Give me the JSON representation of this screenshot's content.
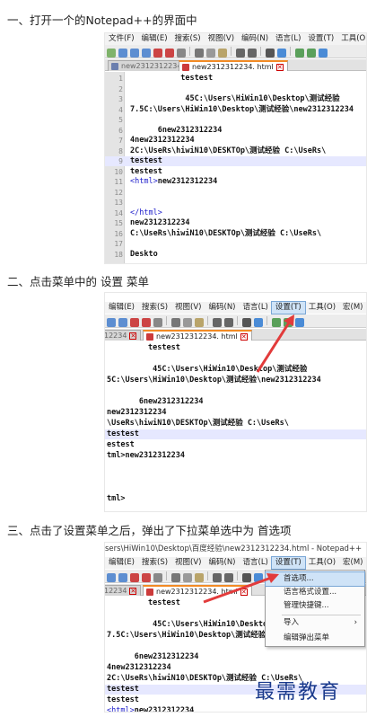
{
  "steps": {
    "one": "一、打开一个的Notepad++的界面中",
    "two": "二、点击菜单中的 设置 菜单",
    "three": "三、点击了设置菜单之后，弹出了下拉菜单选中为 首选项"
  },
  "shot1": {
    "menu": [
      "文件(F)",
      "编辑(E)",
      "搜索(S)",
      "视图(V)",
      "编码(N)",
      "语言(L)",
      "设置(T)",
      "工具(O)",
      "宏"
    ],
    "tab_inactive": "new2312312234",
    "tab_active": "new2312312234. html",
    "lines": [
      {
        "n": "1",
        "t": "           testest"
      },
      {
        "n": "2",
        "t": ""
      },
      {
        "n": "3",
        "t": "            45C:\\Users\\HiWin10\\Desktop\\测试经验"
      },
      {
        "n": "4",
        "t": "7.5C:\\Users\\HiWin10\\Desktop\\测试经验\\new2312312234"
      },
      {
        "n": "5",
        "t": ""
      },
      {
        "n": "6",
        "t": "      6new2312312234"
      },
      {
        "n": "7",
        "t": "4new2312312234"
      },
      {
        "n": "8",
        "t": "2C:\\UseRs\\hiwiN10\\DESKTOp\\测试经验 C:\\UseRs\\"
      },
      {
        "n": "9",
        "t": "testest"
      },
      {
        "n": "10",
        "t": "testest"
      },
      {
        "n": "11",
        "t": "<html>new2312312234"
      },
      {
        "n": "12",
        "t": ""
      },
      {
        "n": "13",
        "t": ""
      },
      {
        "n": "14",
        "t": "</html>"
      },
      {
        "n": "15",
        "t": "new2312312234"
      },
      {
        "n": "16",
        "t": "C:\\UseRs\\hiwiN10\\DESKTOp\\测试经验 C:\\UseRs\\"
      },
      {
        "n": "17",
        "t": ""
      },
      {
        "n": "18",
        "t": "Deskto"
      }
    ]
  },
  "shot2": {
    "menu": [
      "编辑(E)",
      "搜索(S)",
      "视图(V)",
      "编码(N)",
      "语言(L)",
      "设置(T)",
      "工具(O)",
      "宏(M)"
    ],
    "tab_inactive": "12234",
    "tab_active": "new2312312234. html",
    "lines": [
      "         testest",
      "",
      "          45C:\\Users\\HiWin10\\Desktop\\测试经验",
      "5C:\\Users\\HiWin10\\Desktop\\测试经验\\new2312312234",
      "",
      "       6new2312312234",
      "new2312312234",
      "\\UseRs\\hiwiN10\\DESKTOp\\测试经验 C:\\UseRs\\",
      "testest",
      "estest",
      "tml>new2312312234",
      "",
      "",
      "",
      "tml>"
    ]
  },
  "shot3": {
    "title": "sers\\HiWin10\\Desktop\\百度经验\\new2312312234.html - Notepad++",
    "menu": [
      "编辑(E)",
      "搜索(S)",
      "视图(V)",
      "编码(N)",
      "语言(L)",
      "设置(T)",
      "工具(O)",
      "宏(M)",
      "运行"
    ],
    "tab_inactive": "12234",
    "tab_active": "new2312312234. html",
    "lines": [
      "         testest",
      "",
      "          45C:\\Users\\HiWin10\\Desktop\\",
      "7.5C:\\Users\\HiWin10\\Desktop\\测试经验\\",
      "",
      "      6new2312312234",
      "4new2312312234",
      "2C:\\UseRs\\hiwiN10\\DESKTOp\\测试经验 C:\\UseRs\\",
      "testest",
      "testest",
      "<html>new2312312234"
    ],
    "dropdown": {
      "items": [
        "首选项...",
        "语言格式设置...",
        "管理快捷键...",
        "导入",
        "编辑弹出菜单"
      ],
      "submenu_arrow": "›"
    }
  },
  "watermark": "最需教育"
}
